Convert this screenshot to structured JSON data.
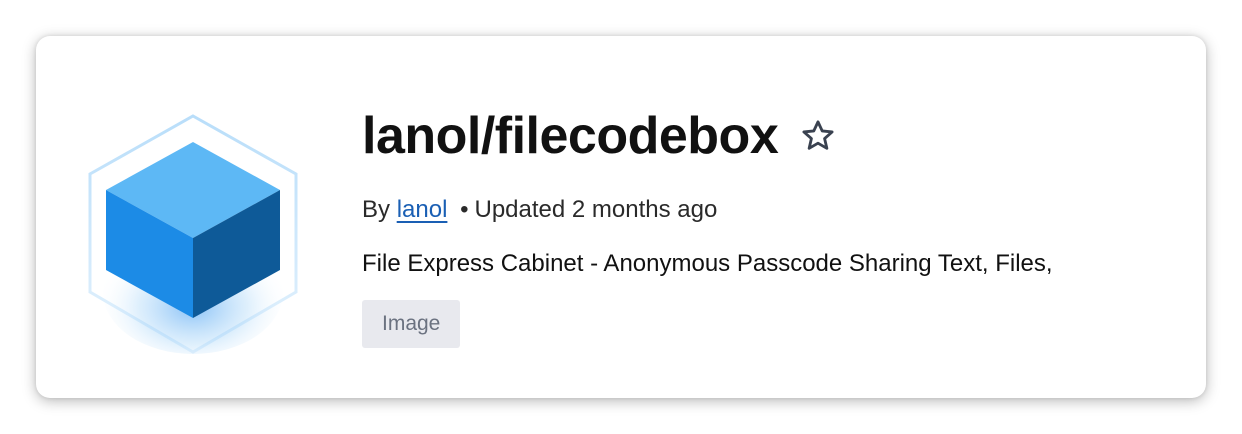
{
  "repository": {
    "title": "lanol/filecodebox",
    "by_prefix": "By",
    "author": "lanol",
    "separator": "•",
    "updated": "Updated 2 months ago",
    "description": "File Express Cabinet - Anonymous Passcode Sharing Text, Files,",
    "tag": "Image"
  },
  "icons": {
    "logo": "cube-logo-icon",
    "star": "star-outline-icon"
  },
  "colors": {
    "link": "#1a5fb4",
    "cube_top": "#5db8f5",
    "cube_left": "#1c8be6",
    "cube_right": "#0e5a98",
    "tag_bg": "#e8e9ee",
    "tag_text": "#6b7280"
  }
}
